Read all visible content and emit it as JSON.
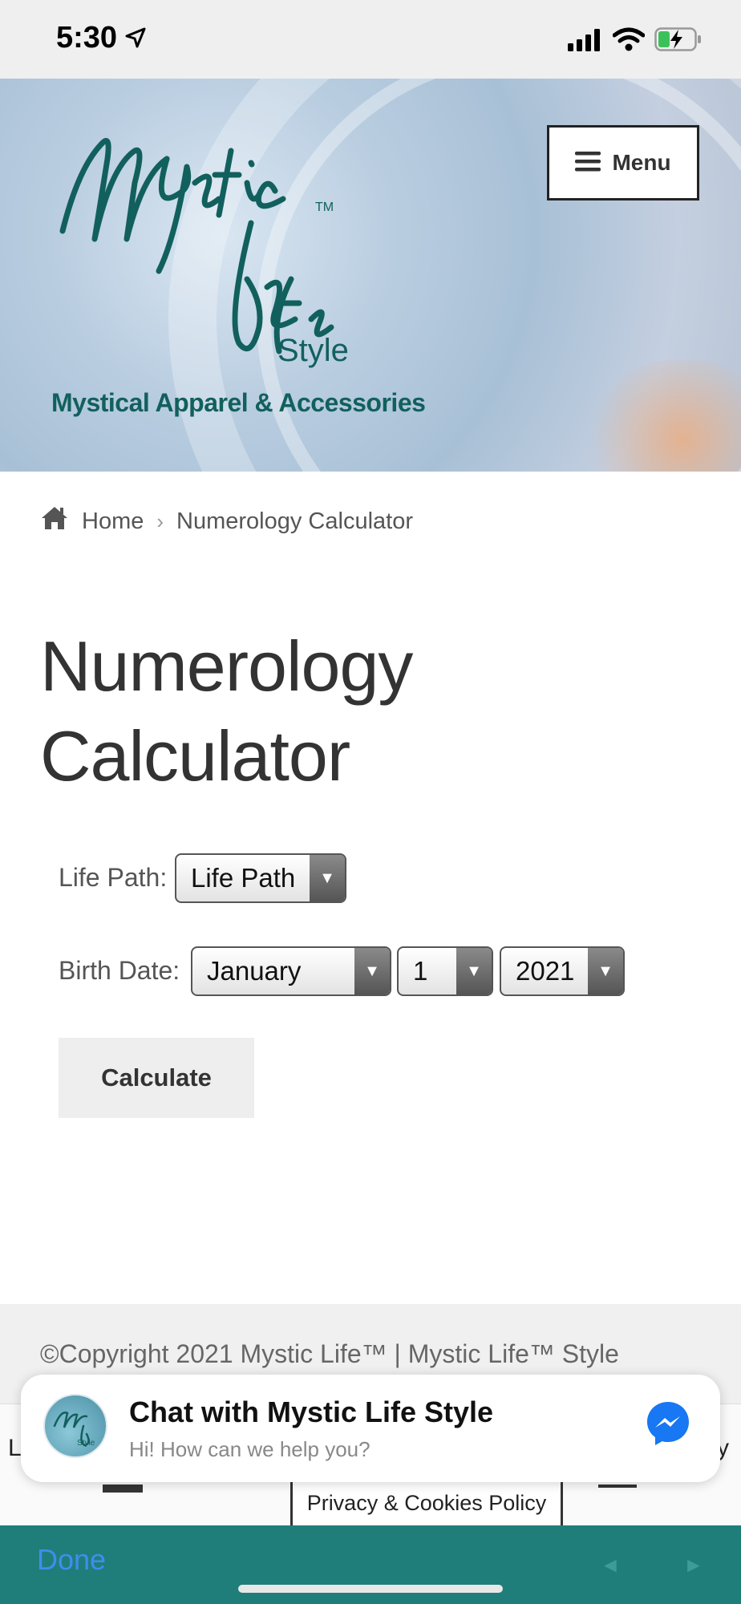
{
  "status_bar": {
    "time": "5:30"
  },
  "header": {
    "logo_tagline": "Mystical Apparel & Accessories",
    "menu_label": "Menu"
  },
  "breadcrumb": {
    "home": "Home",
    "current": "Numerology Calculator"
  },
  "page": {
    "title": "Numerology Calculator"
  },
  "form": {
    "life_path_label": "Life Path:",
    "life_path_value": "Life Path",
    "birth_date_label": "Birth Date:",
    "month": "January",
    "day": "1",
    "year": "2021",
    "calculate_label": "Calculate"
  },
  "footer": {
    "copyright": "©Copyright 2021 Mystic Life™ | Mystic Life™ Style",
    "privacy_link": "Privacy & Cookies Policy",
    "cookie_edge_left": "L",
    "cookie_edge_right": "y"
  },
  "chat": {
    "title": "Chat with Mystic Life Style",
    "subtitle": "Hi! How can we help you?"
  },
  "browser": {
    "done_label": "Done",
    "back_glyph": "◄",
    "forward_glyph": "►"
  },
  "colors": {
    "brand_teal": "#12605e",
    "browser_bar": "#1f7e7a",
    "messenger_blue": "#1877f2",
    "done_blue": "#3d8ef0"
  },
  "icons": [
    "location-arrow-icon",
    "signal-icon",
    "wifi-icon",
    "battery-charging-icon",
    "hamburger-icon",
    "home-icon",
    "chevron-right-icon",
    "dropdown-arrow-icon",
    "messenger-icon"
  ]
}
